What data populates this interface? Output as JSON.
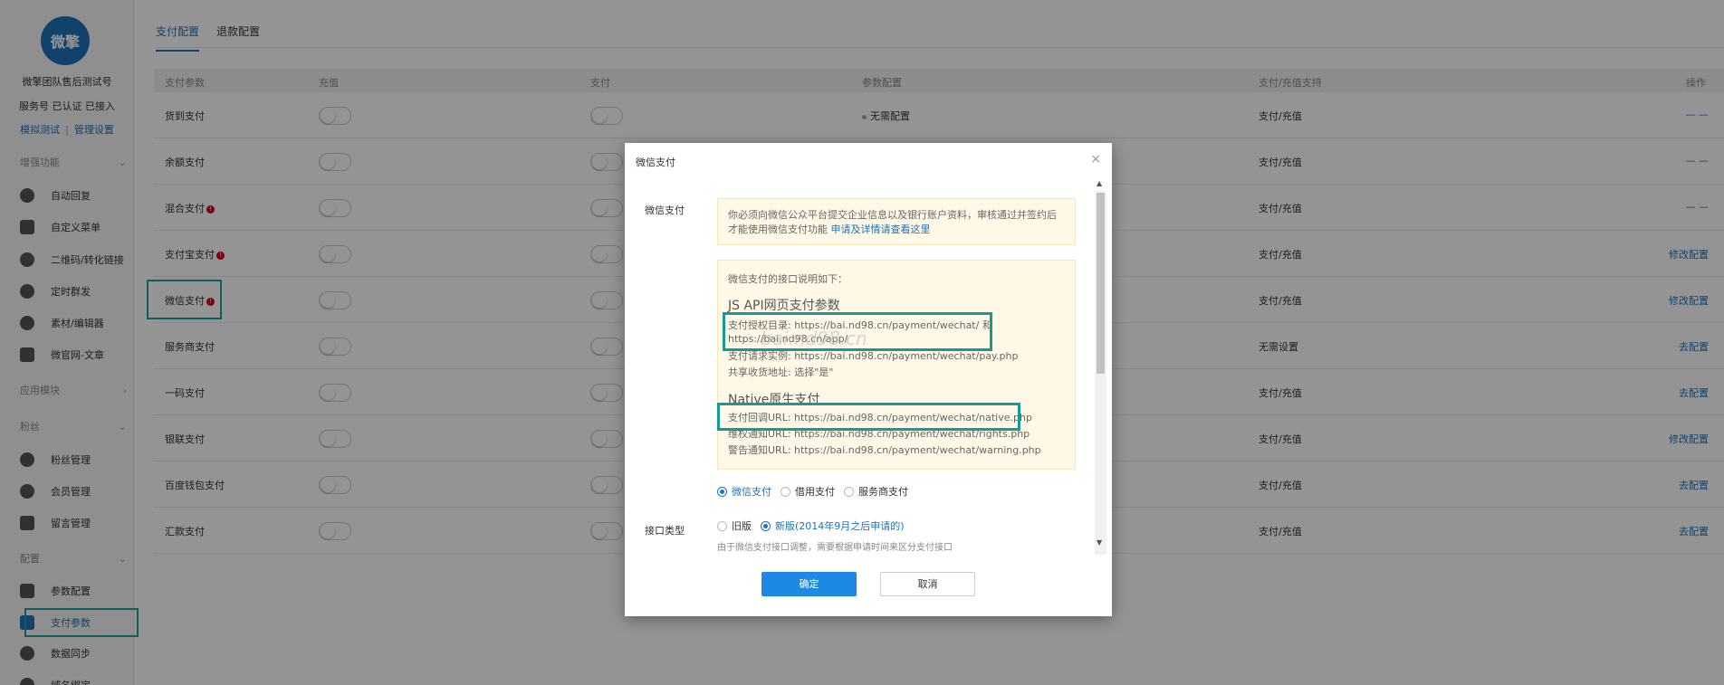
{
  "sidebar": {
    "logo_text": "微擎",
    "account_name": "微擎团队售后测试号",
    "account_status": "服务号 已认证 已接入",
    "link_test": "模拟测试",
    "link_separator": "|",
    "link_manage": "管理设置",
    "sections": [
      {
        "title": "增强功能",
        "chevron": "⌄"
      },
      {
        "title": "应用模块",
        "chevron": "›"
      },
      {
        "title": "粉丝",
        "chevron": "⌄"
      },
      {
        "title": "配置",
        "chevron": "⌄"
      }
    ],
    "items": [
      {
        "label": "自动回复",
        "icon": "chat-bubble-icon"
      },
      {
        "label": "自定义菜单",
        "icon": "menu-edit-icon"
      },
      {
        "label": "二维码/转化链接",
        "icon": "qrcode-icon"
      },
      {
        "label": "定时群发",
        "icon": "clock-icon"
      },
      {
        "label": "素材/编辑器",
        "icon": "compass-icon"
      },
      {
        "label": "微官网-文章",
        "icon": "house-icon"
      },
      {
        "label": "粉丝管理",
        "icon": "heart-icon"
      },
      {
        "label": "会员管理",
        "icon": "heart-icon"
      },
      {
        "label": "留言管理",
        "icon": "envelope-icon"
      },
      {
        "label": "参数配置",
        "icon": "sliders-icon"
      },
      {
        "label": "支付参数",
        "icon": "card-icon"
      },
      {
        "label": "数据同步",
        "icon": "sync-icon"
      },
      {
        "label": "域名绑定",
        "icon": "link-icon"
      }
    ]
  },
  "tabs": [
    "支付配置",
    "退款配置"
  ],
  "table": {
    "headers": [
      "支付参数",
      "充值",
      "支付",
      "参数配置",
      "支付/充值支持",
      "操作"
    ],
    "rows": [
      {
        "name": "货到支付",
        "warn": false,
        "config": "无需配置",
        "support": "支付/充值",
        "action": "— —"
      },
      {
        "name": "余额支付",
        "warn": false,
        "config": "",
        "support": "支付/充值",
        "action": "— —"
      },
      {
        "name": "混合支付",
        "warn": true,
        "config": "",
        "support": "支付/充值",
        "action": "— —"
      },
      {
        "name": "支付宝支付",
        "warn": true,
        "config": "",
        "support": "支付/充值",
        "action": "修改配置"
      },
      {
        "name": "微信支付",
        "warn": true,
        "config": "",
        "support": "支付/充值",
        "action": "修改配置"
      },
      {
        "name": "服务商支付",
        "warn": false,
        "config": "",
        "support": "无需设置",
        "action": "去配置"
      },
      {
        "name": "一码支付",
        "warn": false,
        "config": "",
        "support": "支付/充值",
        "action": "去配置"
      },
      {
        "name": "银联支付",
        "warn": false,
        "config": "",
        "support": "支付/充值",
        "action": "修改配置"
      },
      {
        "name": "百度钱包支付",
        "warn": false,
        "config": "",
        "support": "支付/充值",
        "action": "去配置"
      },
      {
        "name": "汇款支付",
        "warn": false,
        "config": "",
        "support": "支付/充值",
        "action": "去配置"
      }
    ]
  },
  "modal": {
    "title": "微信支付",
    "close": "×",
    "label_wechat": "微信支付",
    "label_api": "接口类型",
    "notice_text": "你必须向微信公众平台提交企业信息以及银行账户资料，审核通过并签约后才能使用微信支付功能",
    "notice_link": "申请及详情请查看这里",
    "info_head": "微信支付的接口说明如下：",
    "jsapi_title": "JS API网页支付参数",
    "auth_dir_1": "支付授权目录: https://bai.nd98.cn/payment/wechat/ 和",
    "auth_dir_2": "https://bai.nd98.cn/app/",
    "req_example": "支付请求实例: https://bai.nd98.cn/payment/wechat/pay.php",
    "share_addr": "共享收货地址: 选择\"是\"",
    "native_title": "Native原生支付",
    "callback_url": "支付回调URL: https://bai.nd98.cn/payment/wechat/native.php",
    "rights_url": "维权通知URL: https://bai.nd98.cn/payment/wechat/rights.php",
    "warning_url": "警告通知URL: https://bai.nd98.cn/payment/wechat/warning.php",
    "pay_types": [
      "微信支付",
      "借用支付",
      "服务商支付"
    ],
    "api_versions": [
      "旧版",
      "新版(2014年9月之后申请的)"
    ],
    "hint": "由于微信支付接口调整，需要根据申请时间来区分支付接口",
    "ok": "确定",
    "cancel": "取消",
    "scroll_up": "▲",
    "scroll_down": "▼"
  },
  "colors": {
    "accent": "#1e73b8",
    "highlight": "#1aa3a3",
    "warn": "#d9001b"
  }
}
